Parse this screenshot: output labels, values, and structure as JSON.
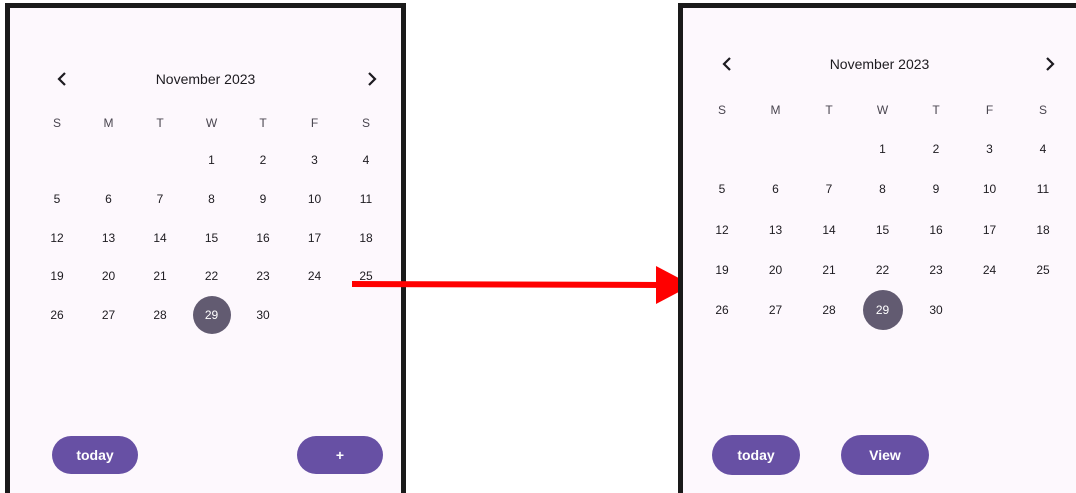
{
  "left_screen": {
    "month_title": "November 2023",
    "prev_icon": "chevron-left-icon",
    "next_icon": "chevron-right-icon",
    "weekdays": [
      "S",
      "M",
      "T",
      "W",
      "T",
      "F",
      "S"
    ],
    "days": [
      "1",
      "2",
      "3",
      "4",
      "5",
      "6",
      "7",
      "8",
      "9",
      "10",
      "11",
      "12",
      "13",
      "14",
      "15",
      "16",
      "17",
      "18",
      "19",
      "20",
      "21",
      "22",
      "23",
      "24",
      "25",
      "26",
      "27",
      "28",
      "29",
      "30"
    ],
    "first_weekday_index": 3,
    "selected_day": "29",
    "buttons": {
      "today_label": "today",
      "add_label": "+"
    }
  },
  "right_screen": {
    "month_title": "November 2023",
    "prev_icon": "chevron-left-icon",
    "next_icon": "chevron-right-icon",
    "weekdays": [
      "S",
      "M",
      "T",
      "W",
      "T",
      "F",
      "S"
    ],
    "days": [
      "1",
      "2",
      "3",
      "4",
      "5",
      "6",
      "7",
      "8",
      "9",
      "10",
      "11",
      "12",
      "13",
      "14",
      "15",
      "16",
      "17",
      "18",
      "19",
      "20",
      "21",
      "22",
      "23",
      "24",
      "25",
      "26",
      "27",
      "28",
      "29",
      "30"
    ],
    "first_weekday_index": 3,
    "selected_day": "29",
    "buttons": {
      "today_label": "today",
      "view_label": "View"
    }
  },
  "colors": {
    "screen_background": "#fdf8fd",
    "accent": "#6750a4",
    "selected_day": "#625b71",
    "arrow": "#ff0000",
    "text": "#1d1b20"
  },
  "transition_arrow_icon": "red-arrow-icon"
}
